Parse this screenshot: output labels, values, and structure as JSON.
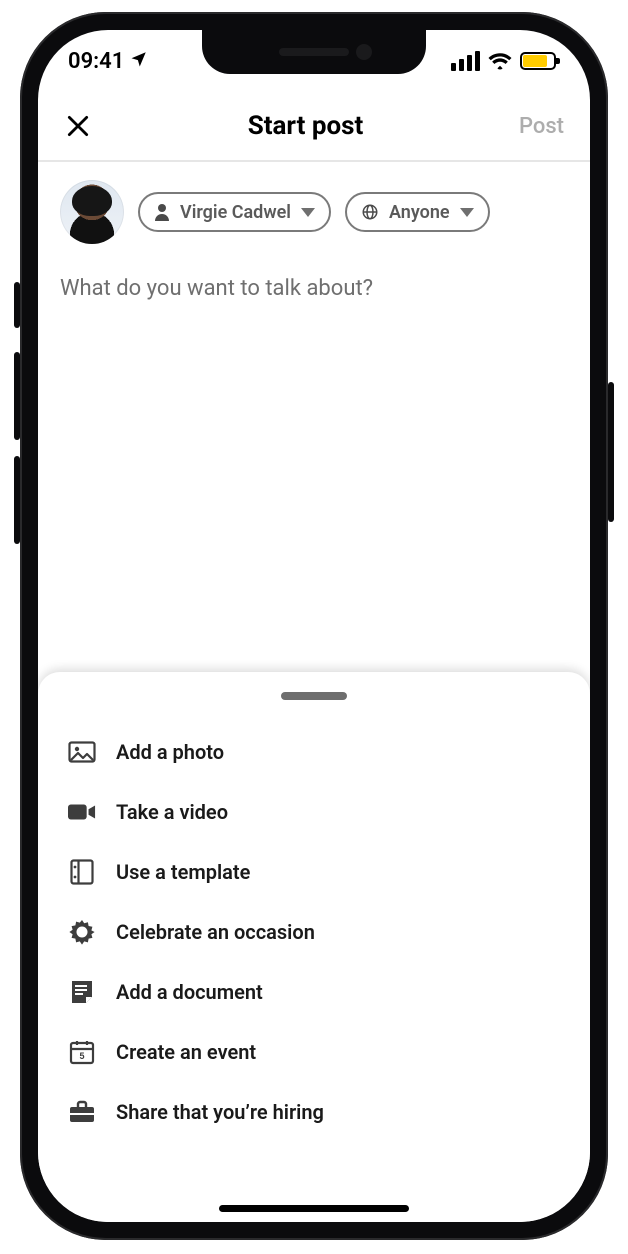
{
  "status": {
    "time": "09:41"
  },
  "header": {
    "title": "Start post",
    "post_label": "Post"
  },
  "author": {
    "name_pill_label": "Virgie Cadwel",
    "audience_pill_label": "Anyone"
  },
  "composer": {
    "placeholder": "What do you want to talk about?"
  },
  "sheet": {
    "items": [
      {
        "label": "Add a photo"
      },
      {
        "label": "Take a video"
      },
      {
        "label": "Use a template"
      },
      {
        "label": "Celebrate an occasion"
      },
      {
        "label": "Add a document"
      },
      {
        "label": "Create an event"
      },
      {
        "label": "Share that you’re hiring"
      }
    ]
  }
}
